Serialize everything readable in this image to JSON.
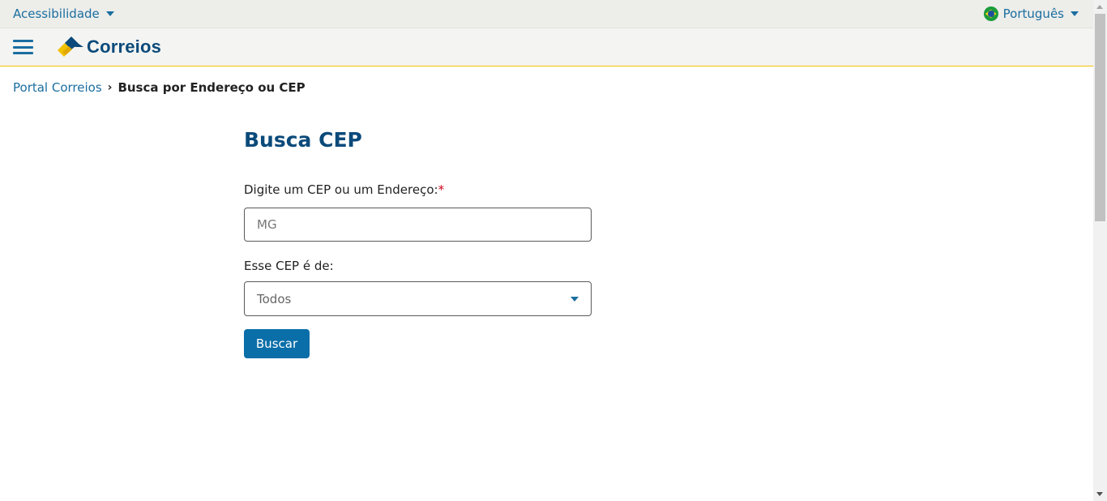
{
  "topbar": {
    "accessibility_label": "Acessibilidade",
    "language_label": "Português",
    "language_flag_icon": "brazil-flag-icon"
  },
  "header": {
    "menu_icon": "hamburger-menu-icon",
    "logo_text": "Correios",
    "colors": {
      "brand_blue": "#0b4a7a",
      "brand_yellow": "#f2c200",
      "link_blue": "#1a6ea0"
    }
  },
  "breadcrumb": {
    "home_label": "Portal Correios",
    "separator": "›",
    "current_label": "Busca por Endereço ou CEP"
  },
  "form": {
    "title": "Busca CEP",
    "cep_label": "Digite um CEP ou um Endereço:",
    "required_mark": "*",
    "cep_value": "MG",
    "type_label": "Esse CEP é de:",
    "type_selected": "Todos",
    "submit_label": "Buscar",
    "button_color": "#0a6ea8"
  }
}
